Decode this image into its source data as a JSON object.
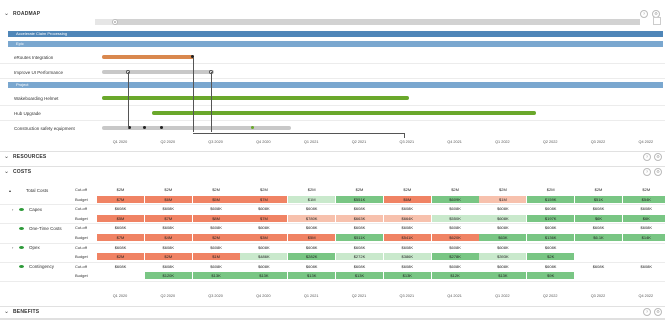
{
  "sections": {
    "roadmap": "ROADMAP",
    "resources": "RESOURCES",
    "costs": "COSTS",
    "benefits": "BENEFITS"
  },
  "roadmap": {
    "timeline_marker": "0",
    "program": "Accelerate Claim Processing",
    "epic_group": "Epic",
    "project_group": "Project",
    "epics": [
      "eRoutes Integration",
      "Improve UI Performance"
    ],
    "projects": [
      "Wakeboarding Helmet",
      "Hub Upgrade",
      "Construction safety equipment"
    ],
    "quarters": [
      "Q1 2020",
      "Q2 2020",
      "Q3 2020",
      "Q4 2020",
      "Q1 2021",
      "Q2 2021",
      "Q3 2021",
      "Q4 2021",
      "Q1 2022",
      "Q2 2022",
      "Q3 2022",
      "Q4 2022"
    ],
    "colors": {
      "program": "#4f86b8",
      "group": "#7aa7cf",
      "orange": "#d9884e",
      "gray": "#c8c8c8",
      "green": "#6aa82b"
    }
  },
  "costs": {
    "quarters": [
      "Q1 2020",
      "Q2 2020",
      "Q3 2020",
      "Q4 2020",
      "Q1 2021",
      "Q2 2021",
      "Q3 2021",
      "Q4 2021",
      "Q1 2022",
      "Q2 2022",
      "Q3 2022",
      "Q4 2022"
    ],
    "rows": [
      {
        "category": "Total Costs",
        "type": "Cut-off",
        "values": [
          "$2M",
          "$2M",
          "$2M",
          "$2M",
          "$2M",
          "$2M",
          "$2M",
          "$2M",
          "$2M",
          "$2M",
          "$2M",
          "$2M"
        ],
        "colors": [
          "",
          "",
          "",
          "",
          "",
          "",
          "",
          "",
          "",
          "",
          "",
          ""
        ]
      },
      {
        "category": "",
        "type": "Budget",
        "values": [
          "$7M",
          "$6M",
          "$5M",
          "$7M",
          "$1M",
          "$551K",
          "$6M",
          "$609K",
          "$1M",
          "$159K",
          "$51K",
          "$54K"
        ],
        "colors": [
          "r",
          "r",
          "r",
          "r",
          "lg",
          "g",
          "r",
          "g",
          "lr",
          "g",
          "g",
          "g"
        ]
      },
      {
        "category": "Capex",
        "type": "Cut-off",
        "values": [
          "$608K",
          "$608K",
          "$608K",
          "$608K",
          "$608K",
          "$608K",
          "$608K",
          "$608K",
          "$608K",
          "$608K",
          "$608K",
          "$608K"
        ],
        "colors": [
          "",
          "",
          "",
          "",
          "",
          "",
          "",
          "",
          "",
          "",
          "",
          ""
        ]
      },
      {
        "category": "",
        "type": "Budget",
        "values": [
          "$5M",
          "$7M",
          "$8M",
          "$7M",
          "$780K",
          "$663K",
          "$664K",
          "$550K",
          "$608K",
          "$197K",
          "$6K",
          "$6K"
        ],
        "colors": [
          "r",
          "r",
          "r",
          "r",
          "lr",
          "lr",
          "lr",
          "lg",
          "lg",
          "g",
          "g",
          "g"
        ]
      },
      {
        "category": "One-Time Costs",
        "type": "Cut-off",
        "values": [
          "$608K",
          "$608K",
          "$608K",
          "$608K",
          "$608K",
          "$608K",
          "$608K",
          "$608K",
          "$608K",
          "$608K",
          "$608K",
          "$608K"
        ],
        "colors": [
          "",
          "",
          "",
          "",
          "",
          "",
          "",
          "",
          "",
          "",
          "",
          ""
        ]
      },
      {
        "category": "",
        "type": "Budget",
        "values": [
          "$7M",
          "$4M",
          "$2M",
          "$3M",
          "$5M",
          "$511K",
          "$541K",
          "$620K",
          "$63K",
          "$136K",
          "$6.1K",
          "$14K"
        ],
        "colors": [
          "r",
          "r",
          "r",
          "r",
          "r",
          "g",
          "r",
          "r",
          "g",
          "g",
          "g",
          "g"
        ]
      },
      {
        "category": "Opex",
        "type": "Cut-off",
        "values": [
          "$608K",
          "$608K",
          "$608K",
          "$608K",
          "$608K",
          "$608K",
          "$608K",
          "$608K",
          "$608K",
          "$608K",
          "",
          ""
        ],
        "colors": [
          "",
          "",
          "",
          "",
          "",
          "",
          "",
          "",
          "",
          "",
          "",
          ""
        ]
      },
      {
        "category": "",
        "type": "Budget",
        "values": [
          "$2M",
          "$2M",
          "$1M",
          "$486K",
          "$282K",
          "$272K",
          "$386K",
          "$278K",
          "$393K",
          "$2K",
          "",
          ""
        ],
        "colors": [
          "r",
          "r",
          "r",
          "lg",
          "g",
          "lg",
          "lg",
          "g",
          "lg",
          "g",
          "",
          ""
        ]
      },
      {
        "category": "Contingency",
        "type": "Cut-off",
        "values": [
          "$608K",
          "$608K",
          "$608K",
          "$608K",
          "$608K",
          "$608K",
          "$608K",
          "$608K",
          "$608K",
          "$608K",
          "$608K",
          "$608K"
        ],
        "colors": [
          "",
          "",
          "",
          "",
          "",
          "",
          "",
          "",
          "",
          "",
          "",
          ""
        ]
      },
      {
        "category": "",
        "type": "Budget",
        "values": [
          "",
          "$120K",
          "$13K",
          "$13K",
          "$13K",
          "$13K",
          "$13K",
          "$12K",
          "$13K",
          "$9K",
          "",
          ""
        ],
        "colors": [
          "",
          "g",
          "g",
          "g",
          "g",
          "g",
          "g",
          "g",
          "g",
          "g",
          "",
          ""
        ]
      }
    ]
  }
}
